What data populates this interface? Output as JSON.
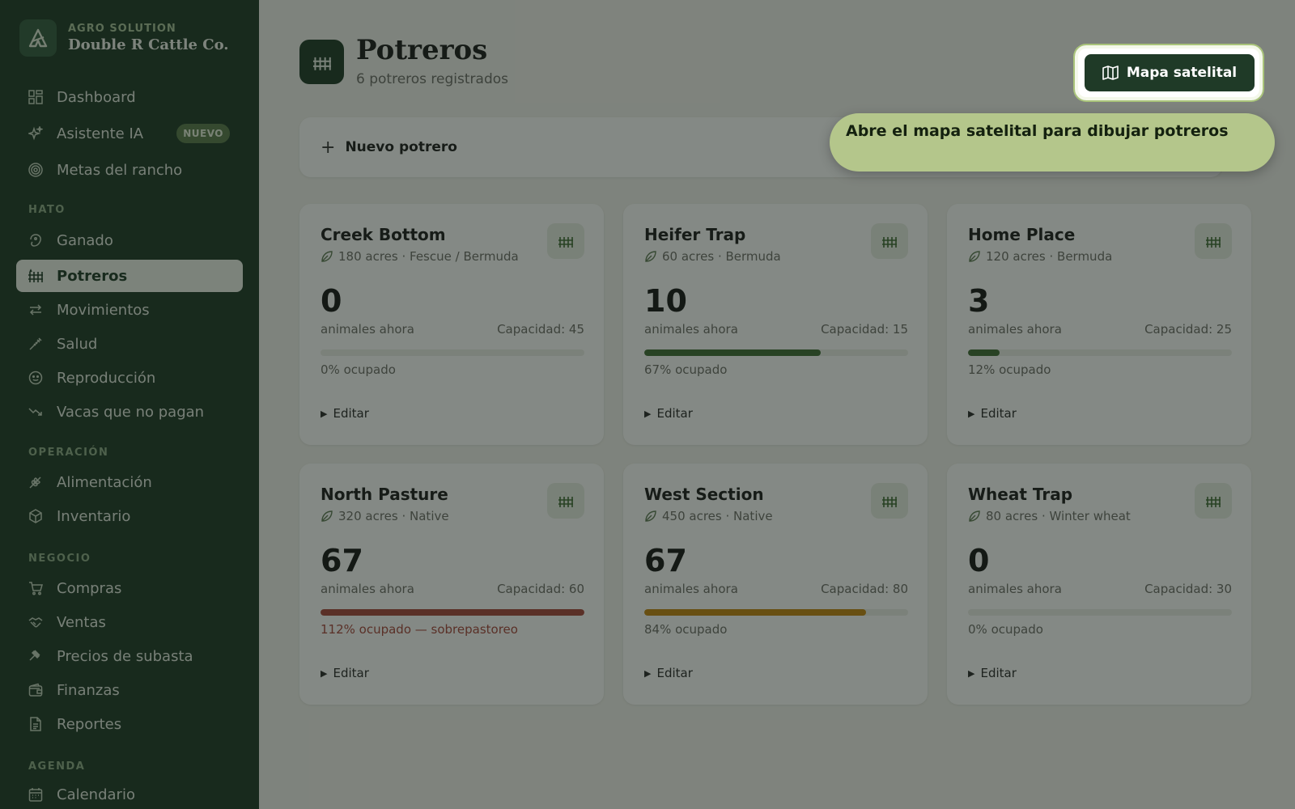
{
  "brand": {
    "kicker": "AGRO SOLUTION",
    "name": "Double R Cattle Co."
  },
  "nav": {
    "dashboard": "Dashboard",
    "asistente": "Asistente IA",
    "asistente_badge": "NUEVO",
    "metas": "Metas del rancho",
    "section_hato": "HATO",
    "ganado": "Ganado",
    "potreros": "Potreros",
    "movimientos": "Movimientos",
    "salud": "Salud",
    "reproduccion": "Reproducción",
    "vacas": "Vacas que no pagan",
    "section_operacion": "OPERACIÓN",
    "alimentacion": "Alimentación",
    "inventario": "Inventario",
    "section_negocio": "NEGOCIO",
    "compras": "Compras",
    "ventas": "Ventas",
    "precios": "Precios de subasta",
    "finanzas": "Finanzas",
    "reportes": "Reportes",
    "section_agenda": "AGENDA",
    "calendario": "Calendario"
  },
  "header": {
    "title": "Potreros",
    "subtitle": "6 potreros registrados"
  },
  "actions": {
    "satellite_button": "Mapa satelital",
    "new_pasture": "Nuevo potrero"
  },
  "tooltip": {
    "text": "Abre el mapa satelital para dibujar potreros"
  },
  "colors": {
    "green": "#3f6b35",
    "amber": "#c4860f",
    "red": "#a8463c",
    "sidebar": "#1f3a27"
  },
  "pastures": [
    {
      "name": "Creek Bottom",
      "meta": "180 acres · Fescue / Bermuda",
      "count": "0",
      "count_label": "animales ahora",
      "capacity": "Capacidad: 45",
      "occupancy": "0% ocupado",
      "fill": 0,
      "status": "normal",
      "edit": "Editar"
    },
    {
      "name": "Heifer Trap",
      "meta": "60 acres · Bermuda",
      "count": "10",
      "count_label": "animales ahora",
      "capacity": "Capacidad: 15",
      "occupancy": "67% ocupado",
      "fill": 67,
      "status": "normal",
      "edit": "Editar"
    },
    {
      "name": "Home Place",
      "meta": "120 acres · Bermuda",
      "count": "3",
      "count_label": "animales ahora",
      "capacity": "Capacidad: 25",
      "occupancy": "12% ocupado",
      "fill": 12,
      "status": "normal",
      "edit": "Editar"
    },
    {
      "name": "North Pasture",
      "meta": "320 acres · Native",
      "count": "67",
      "count_label": "animales ahora",
      "capacity": "Capacidad: 60",
      "occupancy": "112% ocupado — sobrepastoreo",
      "fill": 100,
      "status": "over",
      "edit": "Editar"
    },
    {
      "name": "West Section",
      "meta": "450 acres · Native",
      "count": "67",
      "count_label": "animales ahora",
      "capacity": "Capacidad: 80",
      "occupancy": "84% ocupado",
      "fill": 84,
      "status": "warn",
      "edit": "Editar"
    },
    {
      "name": "Wheat Trap",
      "meta": "80 acres · Winter wheat",
      "count": "0",
      "count_label": "animales ahora",
      "capacity": "Capacidad: 30",
      "occupancy": "0% ocupado",
      "fill": 0,
      "status": "normal",
      "edit": "Editar"
    }
  ]
}
